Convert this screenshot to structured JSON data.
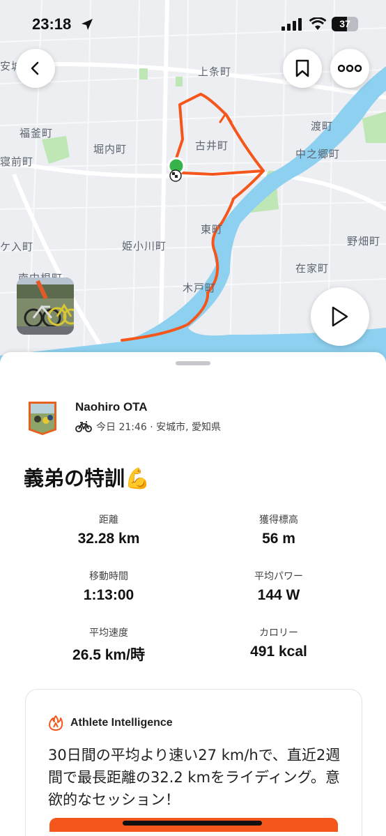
{
  "status_bar": {
    "time": "23:18",
    "battery": "37"
  },
  "map": {
    "labels": [
      "安城",
      "上条町",
      "福釜町",
      "堀内町",
      "古井町",
      "渡町",
      "中之郷町",
      "寝前町",
      "ケ入町",
      "姫小川町",
      "東町",
      "野畑町",
      "在家町",
      "南中根町",
      "木戸町"
    ],
    "route_color": "#f4561b"
  },
  "buttons": {
    "back": "back",
    "bookmark": "bookmark",
    "more": "more",
    "play": "play"
  },
  "athlete": {
    "name": "Naohiro OTA",
    "meta": "今日 21:46 · 安城市, 愛知県"
  },
  "activity": {
    "title": "義弟の特訓💪"
  },
  "stats": [
    {
      "label": "距離",
      "value": "32.28 km"
    },
    {
      "label": "獲得標高",
      "value": "56 m"
    },
    {
      "label": "移動時間",
      "value": "1:13:00"
    },
    {
      "label": "平均パワー",
      "value": "144 W"
    },
    {
      "label": "平均速度",
      "value": "26.5 km/時"
    },
    {
      "label": "カロリー",
      "value": "491 kcal"
    }
  ],
  "athlete_intelligence": {
    "heading": "Athlete Intelligence",
    "body": "30日間の平均より速い27 km/hで、直近2週間で最長距離の32.2 kmをライディング。意欲的なセッション！"
  },
  "colors": {
    "accent": "#f4561b",
    "river": "#8dd0f0",
    "park": "#bfe6b5"
  }
}
